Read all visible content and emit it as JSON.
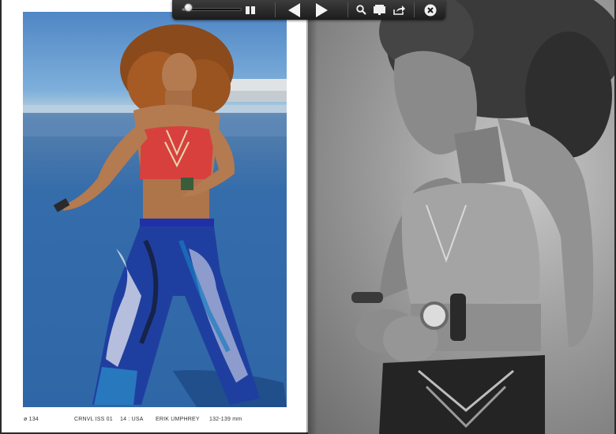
{
  "toolbar": {
    "zoom_level": 0.1,
    "icons": {
      "zoom_slider": "slider",
      "spread_view": "two-page-view-icon",
      "previous": "left-triangle-icon",
      "next": "right-triangle-icon",
      "search": "magnifier-icon",
      "thumbnails": "book-icon",
      "share": "share-arrow-icon",
      "close": "close-circle-icon"
    }
  },
  "folio": {
    "page_number": "ø 134",
    "issue": "CRNVL ISS 01",
    "location": "14 : USA",
    "photographer": "ERIK UMPHREY",
    "measurement": "132-139 mm"
  },
  "colors": {
    "toolbar_bg": "#2a2a2a",
    "page_bg": "#ffffff",
    "top_red": "#d8403e",
    "pants_blue": "#1f3fa0"
  }
}
